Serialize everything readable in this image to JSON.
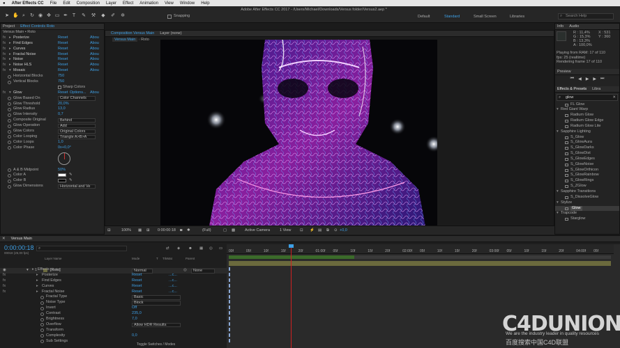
{
  "menubar": {
    "apple": "",
    "app": "After Effects CC",
    "items": [
      "File",
      "Edit",
      "Composition",
      "Layer",
      "Effect",
      "Animation",
      "View",
      "Window",
      "Help"
    ],
    "right": "Sun 12:16"
  },
  "toolbar": {
    "snapping": "Snapping",
    "window_title": "Adobe After Effects CC 2017 - /Users/Michael/Downloads/Versus folder/Versus2.aep *",
    "workspaces": [
      "Default",
      "Standard",
      "Small Screen",
      "Libraries"
    ],
    "search_placeholder": "Search Help"
  },
  "project_panel": {
    "tabs": [
      "Project",
      "Effect Controls Roto"
    ],
    "header": "Versus Main • Roto"
  },
  "effect_controls": {
    "effects": [
      {
        "name": "Posterize",
        "reset": "Reset",
        "about": "Abou"
      },
      {
        "name": "Find Edges",
        "reset": "Reset",
        "about": "Abou"
      },
      {
        "name": "Curves",
        "reset": "Reset",
        "about": "Abou"
      },
      {
        "name": "Fractal Noise",
        "reset": "Reset",
        "about": "Abou"
      },
      {
        "name": "Noise",
        "reset": "Reset",
        "about": "Abou"
      },
      {
        "name": "Noise HLS",
        "reset": "Reset",
        "about": "Abou"
      },
      {
        "name": "Mosaic",
        "reset": "Reset",
        "about": "Abou"
      }
    ],
    "mosaic_props": [
      {
        "name": "Horizontal Blocks",
        "value": "750"
      },
      {
        "name": "Vertical Blocks",
        "value": "750"
      }
    ],
    "sharp_colors": "Sharp Colors",
    "glow": {
      "name": "Glow",
      "reset": "Reset",
      "options": "Options...",
      "about": "Abou"
    },
    "glow_props": [
      {
        "name": "Glow Based On",
        "value": "Color Channels",
        "type": "dropdown"
      },
      {
        "name": "Glow Threshold",
        "value": "20,0%",
        "type": "value"
      },
      {
        "name": "Glow Radius",
        "value": "13,0",
        "type": "value"
      },
      {
        "name": "Glow Intensity",
        "value": "0,7",
        "type": "value"
      },
      {
        "name": "Composite Original",
        "value": "Behind",
        "type": "dropdown"
      },
      {
        "name": "Glow Operation",
        "value": "Add",
        "type": "dropdown"
      },
      {
        "name": "Glow Colors",
        "value": "Original Colors",
        "type": "dropdown"
      },
      {
        "name": "Color Looping",
        "value": "Triangle A>B>A",
        "type": "dropdown"
      },
      {
        "name": "Color Loops",
        "value": "1,0",
        "type": "value"
      },
      {
        "name": "Color Phase",
        "value": "0x+0,0°",
        "type": "value"
      }
    ],
    "ab_props": [
      {
        "name": "A & B Midpoint",
        "value": "50%"
      },
      {
        "name": "Color A",
        "value": ""
      },
      {
        "name": "Color B",
        "value": ""
      },
      {
        "name": "Glow Dimensions",
        "value": "Horizontal and Ve"
      }
    ]
  },
  "viewer": {
    "tabs": [
      "Composition Versus Main",
      "Layer (none)"
    ],
    "breadcrumb": [
      "Versus Main",
      "Roto"
    ],
    "zoom": "100%",
    "timecode": "0:00:00:18",
    "resolution": "(Full)",
    "camera": "Active Camera",
    "views": "1 View",
    "exposure": "+0,0"
  },
  "info_panel": {
    "tabs": [
      "Info",
      "Audio"
    ],
    "r": "R : 11,4%",
    "g": "G : 15,3%",
    "b": "B : 13,3%",
    "a": "A : 100,0%",
    "x": "X : 531",
    "y": "Y : 360",
    "status1": "Playing from RAM: 17 of 110",
    "status2": "fps: 25 (realtime)",
    "status3": "Rendering frame 17 of 110"
  },
  "preview_panel": {
    "title": "Preview"
  },
  "effects_presets": {
    "tabs": [
      "Effects & Presets",
      "Libra"
    ],
    "search": "glow",
    "items": [
      {
        "text": "FL Glow",
        "indent": 2
      },
      {
        "text": "Red Giant Warp",
        "indent": 0
      },
      {
        "text": "Radium Glow",
        "indent": 2
      },
      {
        "text": "Radium Glow Edge",
        "indent": 2
      },
      {
        "text": "Radium Glow Lite",
        "indent": 2
      },
      {
        "text": "Sapphire Lighting",
        "indent": 0
      },
      {
        "text": "S_Glow",
        "indent": 2
      },
      {
        "text": "S_GlowAura",
        "indent": 2
      },
      {
        "text": "S_GlowDarks",
        "indent": 2
      },
      {
        "text": "S_GlowDist",
        "indent": 2
      },
      {
        "text": "S_GlowEdges",
        "indent": 2
      },
      {
        "text": "S_GlowNoise",
        "indent": 2
      },
      {
        "text": "S_GlowOrthicon",
        "indent": 2
      },
      {
        "text": "S_GlowRainbow",
        "indent": 2
      },
      {
        "text": "S_GlowRings",
        "indent": 2
      },
      {
        "text": "S_ZGlow",
        "indent": 2
      },
      {
        "text": "Sapphire Transitions",
        "indent": 0
      },
      {
        "text": "S_DissolveGlow",
        "indent": 2
      },
      {
        "text": "Stylize",
        "indent": 0
      },
      {
        "text": "Glow",
        "indent": 2,
        "selected": true
      },
      {
        "text": "Trapcode",
        "indent": 0
      },
      {
        "text": "Starglow",
        "indent": 2
      }
    ]
  },
  "timeline": {
    "tab": "Versus Main",
    "timecode": "0:00:00:18",
    "fps_note": "00018 (25,00 fps)",
    "columns": [
      "Layer Name",
      "Mode",
      "T",
      "TrkMat",
      "Parent"
    ],
    "layer": {
      "index": "1",
      "name": "[Roto]",
      "mode": "Normal",
      "parent": "None"
    },
    "rows": [
      {
        "name": "Effects",
        "indent": 1,
        "fx": false,
        "reset": "",
        "value": ""
      },
      {
        "name": "Posterize",
        "indent": 2,
        "fx": true,
        "reset": "Reset",
        "value": "...c..."
      },
      {
        "name": "Find Edges",
        "indent": 2,
        "fx": true,
        "reset": "Reset",
        "value": "...c..."
      },
      {
        "name": "Curves",
        "indent": 2,
        "fx": true,
        "reset": "Reset",
        "value": "...c..."
      },
      {
        "name": "Fractal Noise",
        "indent": 2,
        "fx": true,
        "reset": "Reset",
        "value": "...c..."
      },
      {
        "name": "Fractal Type",
        "indent": 3,
        "fx": false,
        "reset": "",
        "value": "Basic",
        "dd": true
      },
      {
        "name": "Noise Type",
        "indent": 3,
        "fx": false,
        "reset": "",
        "value": "Block",
        "dd": true
      },
      {
        "name": "Invert",
        "indent": 3,
        "fx": false,
        "reset": "",
        "value": "Off"
      },
      {
        "name": "Contrast",
        "indent": 3,
        "fx": false,
        "reset": "",
        "value": "235,0"
      },
      {
        "name": "Brightness",
        "indent": 3,
        "fx": false,
        "reset": "",
        "value": "7,0"
      },
      {
        "name": "Overflow",
        "indent": 3,
        "fx": false,
        "reset": "",
        "value": "Allow HDR Results",
        "dd": true
      },
      {
        "name": "Transform",
        "indent": 3,
        "fx": false,
        "reset": "",
        "value": ""
      },
      {
        "name": "Complexity",
        "indent": 3,
        "fx": false,
        "reset": "",
        "value": "0,0"
      },
      {
        "name": "Sub Settings",
        "indent": 3,
        "fx": false,
        "reset": "",
        "value": ""
      }
    ],
    "ruler": [
      "00f",
      "05f",
      "10f",
      "15f",
      "20f",
      "01:00f",
      "05f",
      "10f",
      "15f",
      "20f",
      "02:00f",
      "05f",
      "10f",
      "15f",
      "20f",
      "03:00f",
      "05f",
      "10f",
      "15f",
      "20f",
      "04:00f",
      "05f"
    ],
    "toggle": "Toggle Switches / Modes"
  },
  "watermark": {
    "logo": "C4DUNION",
    "tagline": "We are the industry leader in quality resources",
    "cn": "百度搜索中国C4D联盟"
  }
}
